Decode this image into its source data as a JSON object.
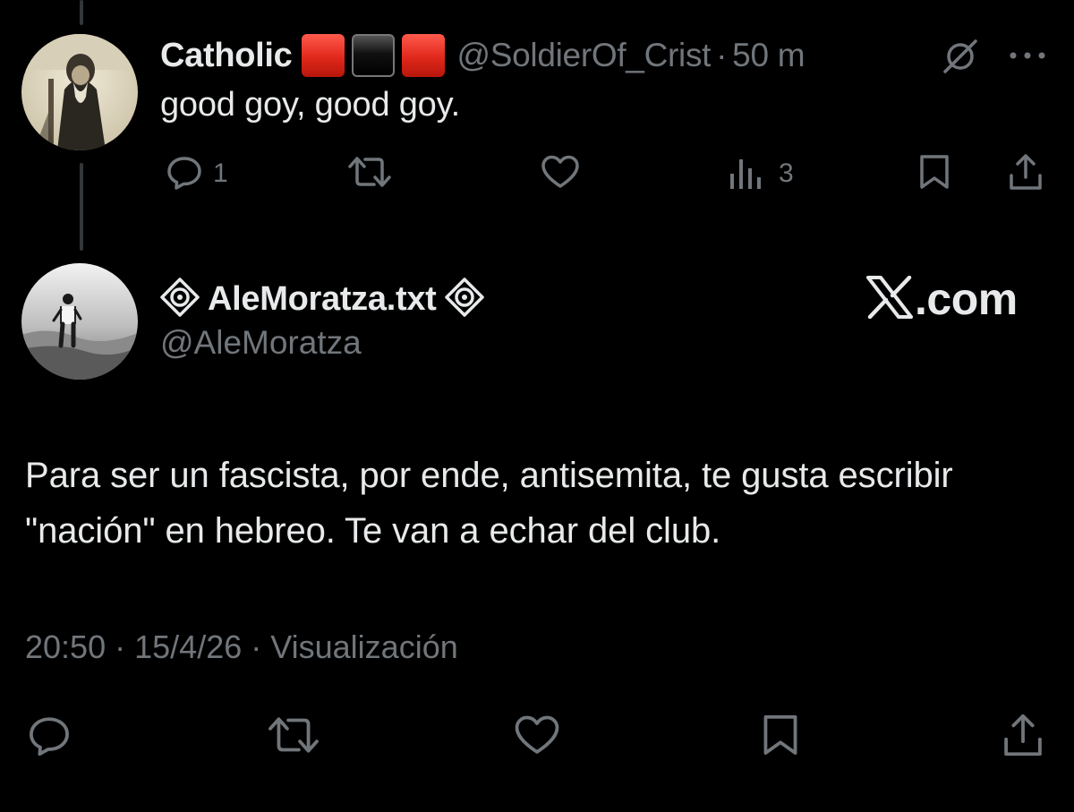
{
  "reply": {
    "display_name": "Catholic",
    "flag_colors": [
      "#e0281b",
      "#000000",
      "#e0281b"
    ],
    "handle": "@SoldierOf_Crist",
    "separator": "·",
    "time_ago": "50 m",
    "text": "good goy, good goy.",
    "replies_count": "1",
    "views_count": "3",
    "icons": [
      "grok-icon",
      "more-icon",
      "reply-icon",
      "retweet-icon",
      "like-icon",
      "views-icon",
      "bookmark-icon",
      "share-icon"
    ]
  },
  "main_tweet": {
    "display_name": "AleMoratza.txt",
    "handle": "@AleMoratza",
    "brand": ".com",
    "text": "Para ser un fascista, por ende, antisemita, te gusta escribir \"nación\" en hebreo. Te van a echar del club.",
    "time": "20:50",
    "date": "15/4/26",
    "views_label": "Visualización",
    "separator": "·",
    "icons": [
      "reply-icon",
      "retweet-icon",
      "like-icon",
      "bookmark-icon",
      "share-icon"
    ]
  },
  "colors": {
    "background": "#000000",
    "text_primary": "#e7e9ea",
    "text_secondary": "#71767b",
    "thread_line": "#333639"
  }
}
